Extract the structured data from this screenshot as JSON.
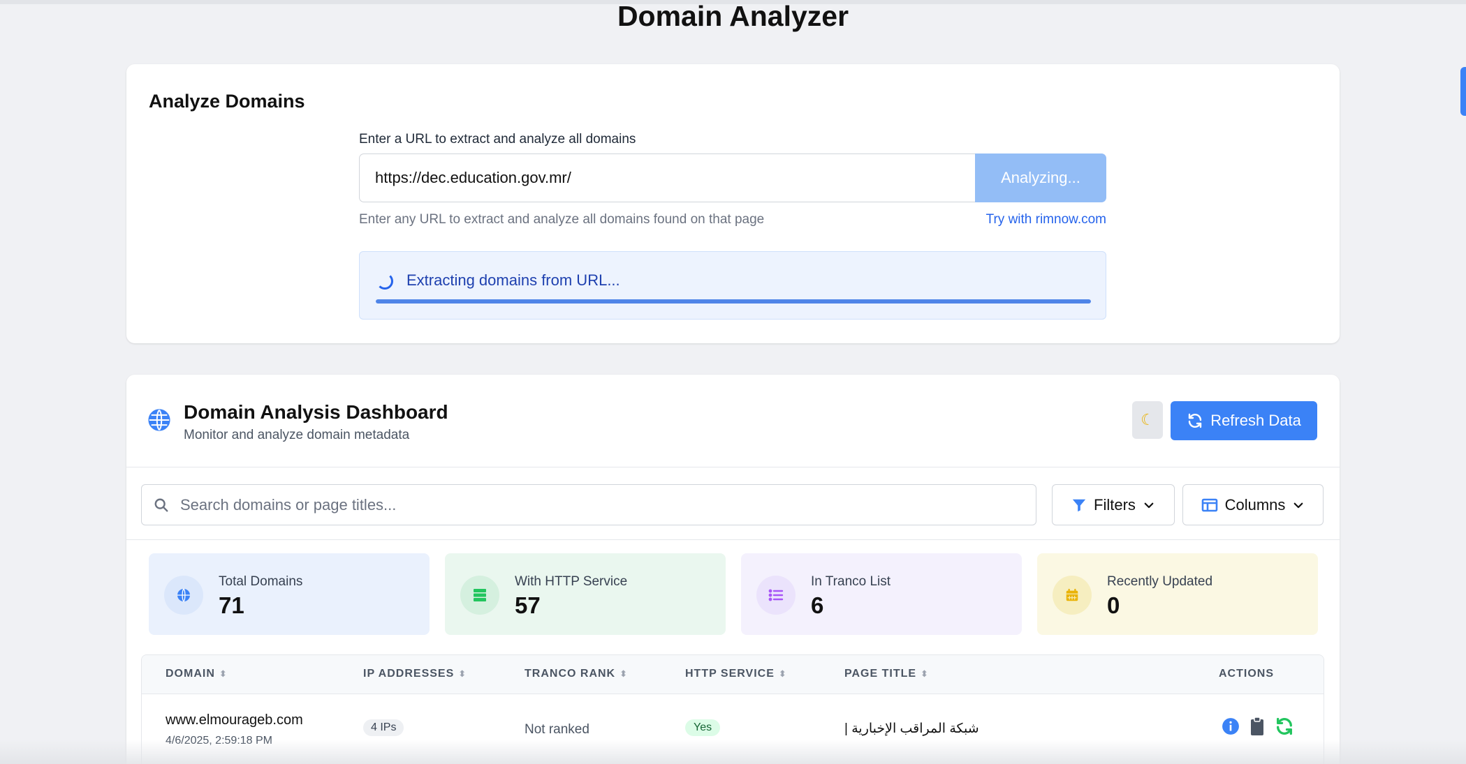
{
  "page": {
    "title": "Domain Analyzer"
  },
  "analyze": {
    "heading": "Analyze Domains",
    "label": "Enter a URL to extract and analyze all domains",
    "url_value": "https://dec.education.gov.mr/",
    "button_label": "Analyzing...",
    "help_text": "Enter any URL to extract and analyze all domains found on that page",
    "try_link": "Try with rimnow.com",
    "progress_text": "Extracting domains from URL...",
    "progress_fraction": 1.0
  },
  "dashboard": {
    "title": "Domain Analysis Dashboard",
    "subtitle": "Monitor and analyze domain metadata",
    "refresh_label": "Refresh Data",
    "search_placeholder": "Search domains or page titles...",
    "filters_label": "Filters",
    "columns_label": "Columns",
    "stats": [
      {
        "label": "Total Domains",
        "value": "71",
        "icon": "globe-icon",
        "bg": "#eaf1fd",
        "icon_bg": "#dbe7fb",
        "icon_color": "#3b82f6"
      },
      {
        "label": "With HTTP Service",
        "value": "57",
        "icon": "server-icon",
        "bg": "#eaf7ef",
        "icon_bg": "#d5f0df",
        "icon_color": "#22c55e"
      },
      {
        "label": "In Tranco List",
        "value": "6",
        "icon": "list-icon",
        "bg": "#f4f1fd",
        "icon_bg": "#ebe3fc",
        "icon_color": "#a855f7"
      },
      {
        "label": "Recently Updated",
        "value": "0",
        "icon": "calendar-icon",
        "bg": "#fbf8e3",
        "icon_bg": "#f6eec0",
        "icon_color": "#eab308"
      }
    ],
    "table": {
      "columns": [
        "DOMAIN",
        "IP ADDRESSES",
        "TRANCO RANK",
        "HTTP SERVICE",
        "PAGE TITLE",
        "ACTIONS"
      ],
      "rows": [
        {
          "domain": "www.elmourageb.com",
          "date": "4/6/2025, 2:59:18 PM",
          "ips": "4 IPs",
          "rank": "Not ranked",
          "http": "Yes",
          "page_title": "شبكة المراقب الإخبارية |"
        }
      ]
    }
  },
  "colors": {
    "accent": "#3b82f6",
    "accent_disabled": "#93bdf6",
    "link": "#2563eb"
  }
}
